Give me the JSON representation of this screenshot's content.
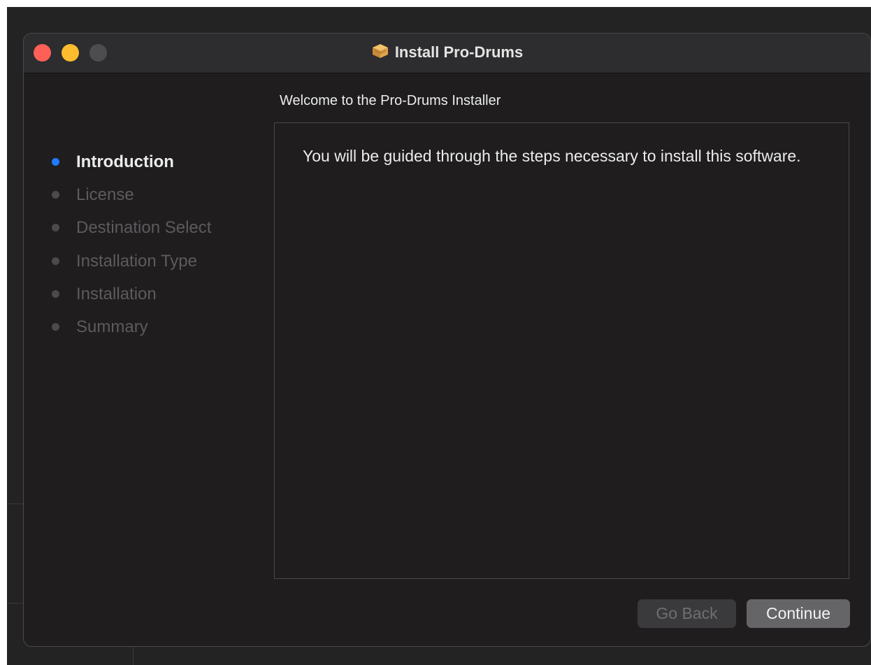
{
  "window": {
    "title": "Install Pro-Drums",
    "title_icon": "package-icon"
  },
  "heading": "Welcome to the Pro-Drums Installer",
  "steps": [
    {
      "label": "Introduction",
      "active": true
    },
    {
      "label": "License",
      "active": false
    },
    {
      "label": "Destination Select",
      "active": false
    },
    {
      "label": "Installation Type",
      "active": false
    },
    {
      "label": "Installation",
      "active": false
    },
    {
      "label": "Summary",
      "active": false
    }
  ],
  "content": {
    "body": "You will be guided through the steps necessary to install this software."
  },
  "buttons": {
    "back_label": "Go Back",
    "continue_label": "Continue"
  },
  "colors": {
    "accent": "#1f7cff",
    "close": "#fe5f57",
    "minimize": "#febc2e",
    "zoom": "#4d4d4f"
  }
}
